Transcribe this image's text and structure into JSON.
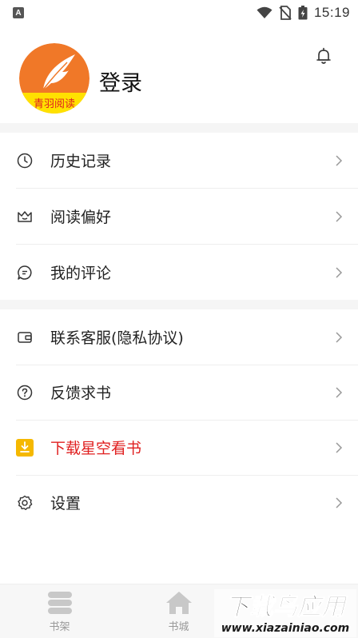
{
  "status_bar": {
    "time": "15:19"
  },
  "header": {
    "logo_text": "青羽阅读",
    "login_label": "登录"
  },
  "menu_group_1": [
    {
      "label": "历史记录",
      "icon": "clock-icon"
    },
    {
      "label": "阅读偏好",
      "icon": "crown-icon"
    },
    {
      "label": "我的评论",
      "icon": "chat-bubble-icon"
    }
  ],
  "menu_group_2": [
    {
      "label": "联系客服(隐私协议)",
      "icon": "wallet-icon"
    },
    {
      "label": "反馈求书",
      "icon": "question-circle-icon"
    },
    {
      "label": "下载星空看书",
      "icon": "download-icon",
      "accent": "#e02020"
    },
    {
      "label": "设置",
      "icon": "gear-icon"
    }
  ],
  "bottom_nav": [
    {
      "label": "书架",
      "icon": "bookshelf-icon"
    },
    {
      "label": "书城",
      "icon": "home-icon"
    }
  ],
  "watermark": {
    "line1": "下载鸟应用",
    "line2": "www.xiazainiao.com"
  },
  "colors": {
    "accent_red": "#e02020",
    "download_icon_bg": "#f5b800",
    "logo_orange": "#f07828",
    "logo_yellow": "#ffe100"
  }
}
